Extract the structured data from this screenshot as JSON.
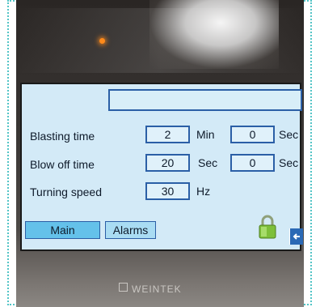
{
  "screen": {
    "title_value": "",
    "rows": [
      {
        "label": "Blasting time",
        "value1": "2",
        "unit1": "Min",
        "value2": "0",
        "unit2": "Sec"
      },
      {
        "label": "Blow off time",
        "value1": "20",
        "unit1": "Sec",
        "value2": "0",
        "unit2": "Sec"
      },
      {
        "label": "Turning speed",
        "value1": "30",
        "unit1": "Hz"
      }
    ],
    "buttons": {
      "main": "Main",
      "alarms": "Alarms"
    },
    "icons": {
      "lock": "lock-icon",
      "back": "back-arrow-icon"
    }
  },
  "device": {
    "brand": "WEINTEK",
    "led_color": "#ff8a1a"
  },
  "colors": {
    "screen_bg": "#d3eaf7",
    "box_border": "#2b5fa6",
    "main_button": "#64c1ea",
    "alarms_button": "#a9dcf3"
  }
}
